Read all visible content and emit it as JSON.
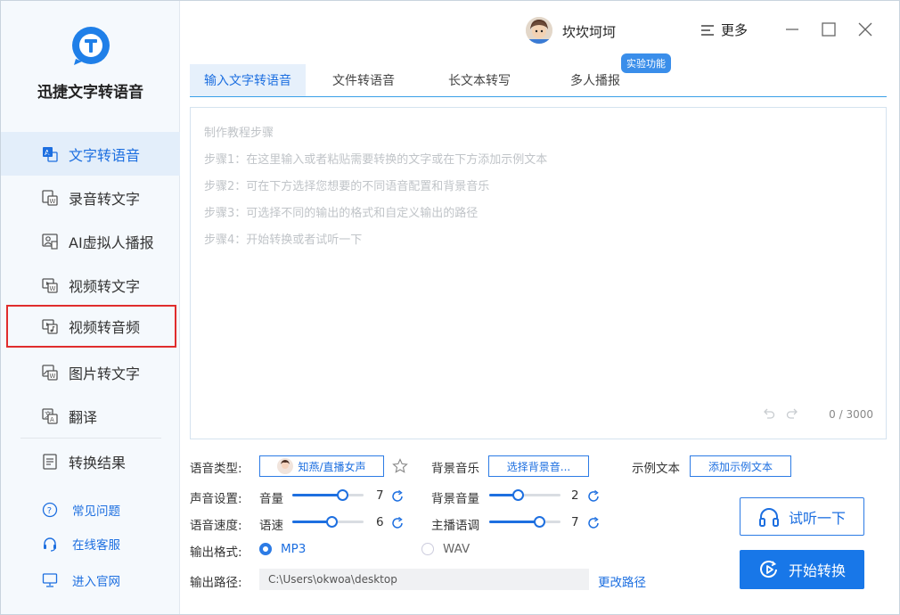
{
  "app": {
    "name": "迅捷文字转语音",
    "accent_color": "#1877e8"
  },
  "sidebar": {
    "items": [
      {
        "label": "文字转语音",
        "icon": "text-to-speech-icon"
      },
      {
        "label": "录音转文字",
        "icon": "recording-icon"
      },
      {
        "label": "AI虚拟人播报",
        "icon": "ai-avatar-icon"
      },
      {
        "label": "视频转文字",
        "icon": "video-text-icon"
      },
      {
        "label": "视频转音频",
        "icon": "video-audio-icon"
      },
      {
        "label": "图片转文字",
        "icon": "image-text-icon"
      },
      {
        "label": "翻译",
        "icon": "translate-icon"
      },
      {
        "label": "转换结果",
        "icon": "results-icon"
      }
    ],
    "help": [
      {
        "label": "常见问题",
        "icon": "question-icon"
      },
      {
        "label": "在线客服",
        "icon": "headset-icon"
      },
      {
        "label": "进入官网",
        "icon": "monitor-icon"
      }
    ]
  },
  "header": {
    "username": "坎坎坷坷",
    "more_label": "更多"
  },
  "tabs": [
    {
      "label": "输入文字转语音"
    },
    {
      "label": "文件转语音"
    },
    {
      "label": "长文本转写"
    },
    {
      "label": "多人播报"
    }
  ],
  "badge": "实验功能",
  "editor": {
    "lines": [
      "制作教程步骤",
      "步骤1：在这里输入或者粘贴需要转换的文字或在下方添加示例文本",
      "步骤2：可在下方选择您想要的不同语音配置和背景音乐",
      "步骤3：可选择不同的输出的格式和自定义输出的路径",
      "步骤4：开始转换或者试听一下"
    ],
    "counter": "0 / 3000"
  },
  "settings": {
    "voice_type_label": "语音类型:",
    "voice_name": "知燕/直播女声",
    "bg_music_label": "背景音乐",
    "bg_music_button": "选择背景音...",
    "sample_label": "示例文本",
    "sample_button": "添加示例文本",
    "sound_label": "声音设置:",
    "volume_label": "音量",
    "volume_value": "7",
    "volume_fraction": 0.7,
    "bg_volume_label": "背景音量",
    "bg_volume_value": "2",
    "bg_volume_fraction": 0.4,
    "speed_row_label": "语音速度:",
    "speed_label": "语速",
    "speed_value": "6",
    "speed_fraction": 0.55,
    "pitch_label": "主播语调",
    "pitch_value": "7",
    "pitch_fraction": 0.7,
    "format_label": "输出格式:",
    "format_mp3": "MP3",
    "format_wav": "WAV",
    "selected_format": "MP3",
    "path_label": "输出路径:",
    "path_value": "C:\\Users\\okwoa\\desktop",
    "change_path": "更改路径"
  },
  "actions": {
    "listen": "试听一下",
    "start": "开始转换"
  }
}
